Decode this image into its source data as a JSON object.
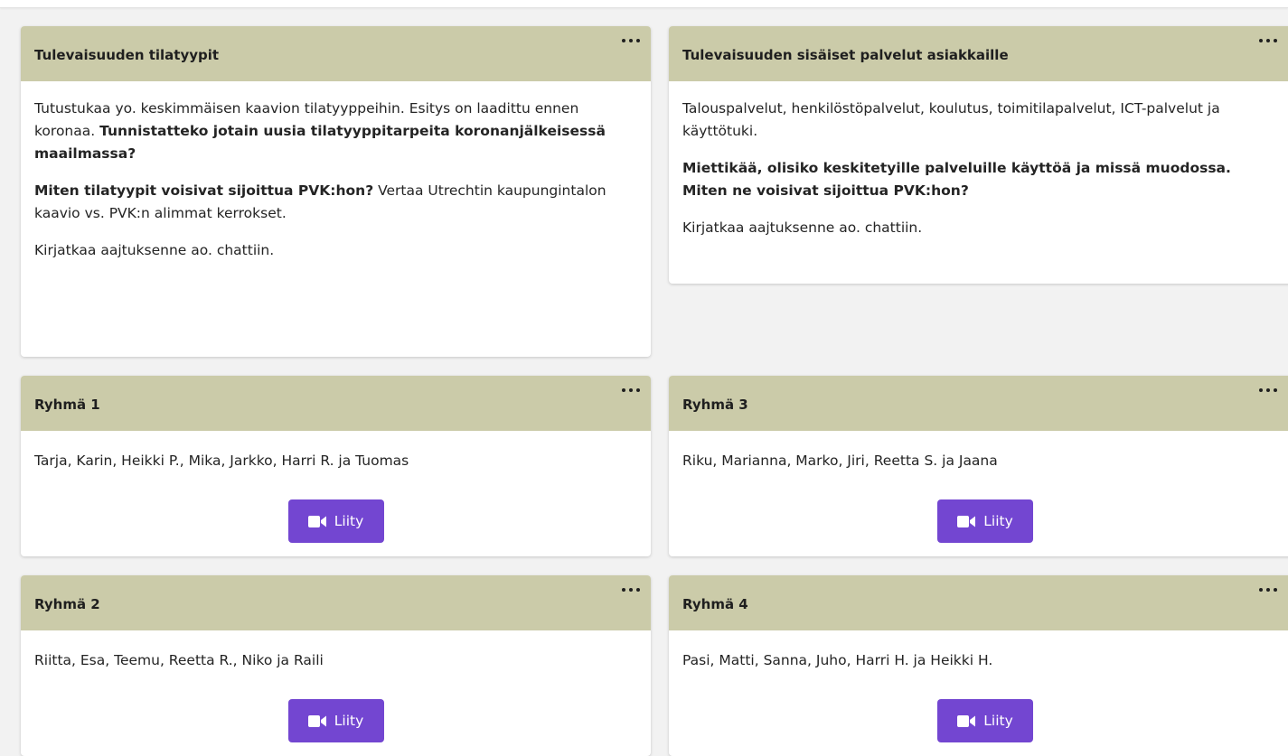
{
  "cards": {
    "spaces": {
      "title": "Tulevaisuuden tilatyypit",
      "p1_a": "Tutustukaa yo. keskimmäisen kaavion tilatyyppeihin. Esitys on laadittu ennen koronaa. ",
      "p1_b": "Tunnistatteko jotain uusia tilatyyppitarpeita koronanjälkeisessä maailmassa?",
      "p2_a": "Miten tilatyypit voisivat sijoittua PVK:hon?",
      "p2_b": " Vertaa Utrechtin kaupungintalon kaavio vs. PVK:n alimmat kerrokset.",
      "p3": "Kirjatkaa aajtuksenne ao. chattiin."
    },
    "services": {
      "title": "Tulevaisuuden sisäiset palvelut asiakkaille",
      "p1": "Talouspalvelut, henkilöstöpalvelut, koulutus, toimitilapalvelut, ICT-palvelut ja käyttötuki.",
      "p2": "Miettikää, olisiko keskitetyille palveluille käyttöä ja missä muodossa. Miten ne voisivat sijoittua PVK:hon?",
      "p3": "Kirjatkaa aajtuksenne ao. chattiin."
    }
  },
  "groups": [
    {
      "title": "Ryhmä 1",
      "members": "Tarja, Karin, Heikki P., Mika, Jarkko, Harri R. ja Tuomas",
      "join_label": "Liity"
    },
    {
      "title": "Ryhmä 3",
      "members": "Riku, Marianna, Marko, Jiri, Reetta S. ja Jaana",
      "join_label": "Liity"
    },
    {
      "title": "Ryhmä 2",
      "members": "Riitta, Esa, Teemu, Reetta R., Niko ja Raili",
      "join_label": "Liity"
    },
    {
      "title": "Ryhmä 4",
      "members": "Pasi, Matti, Sanna, Juho, Harri H. ja Heikki H.",
      "join_label": "Liity"
    }
  ],
  "colors": {
    "header_bg": "#cbcba9",
    "join_button": "#7346d1",
    "page_bg": "#f2f2f2"
  },
  "icons": {
    "more": "more-horizontal-icon",
    "join": "video-camera-icon"
  }
}
